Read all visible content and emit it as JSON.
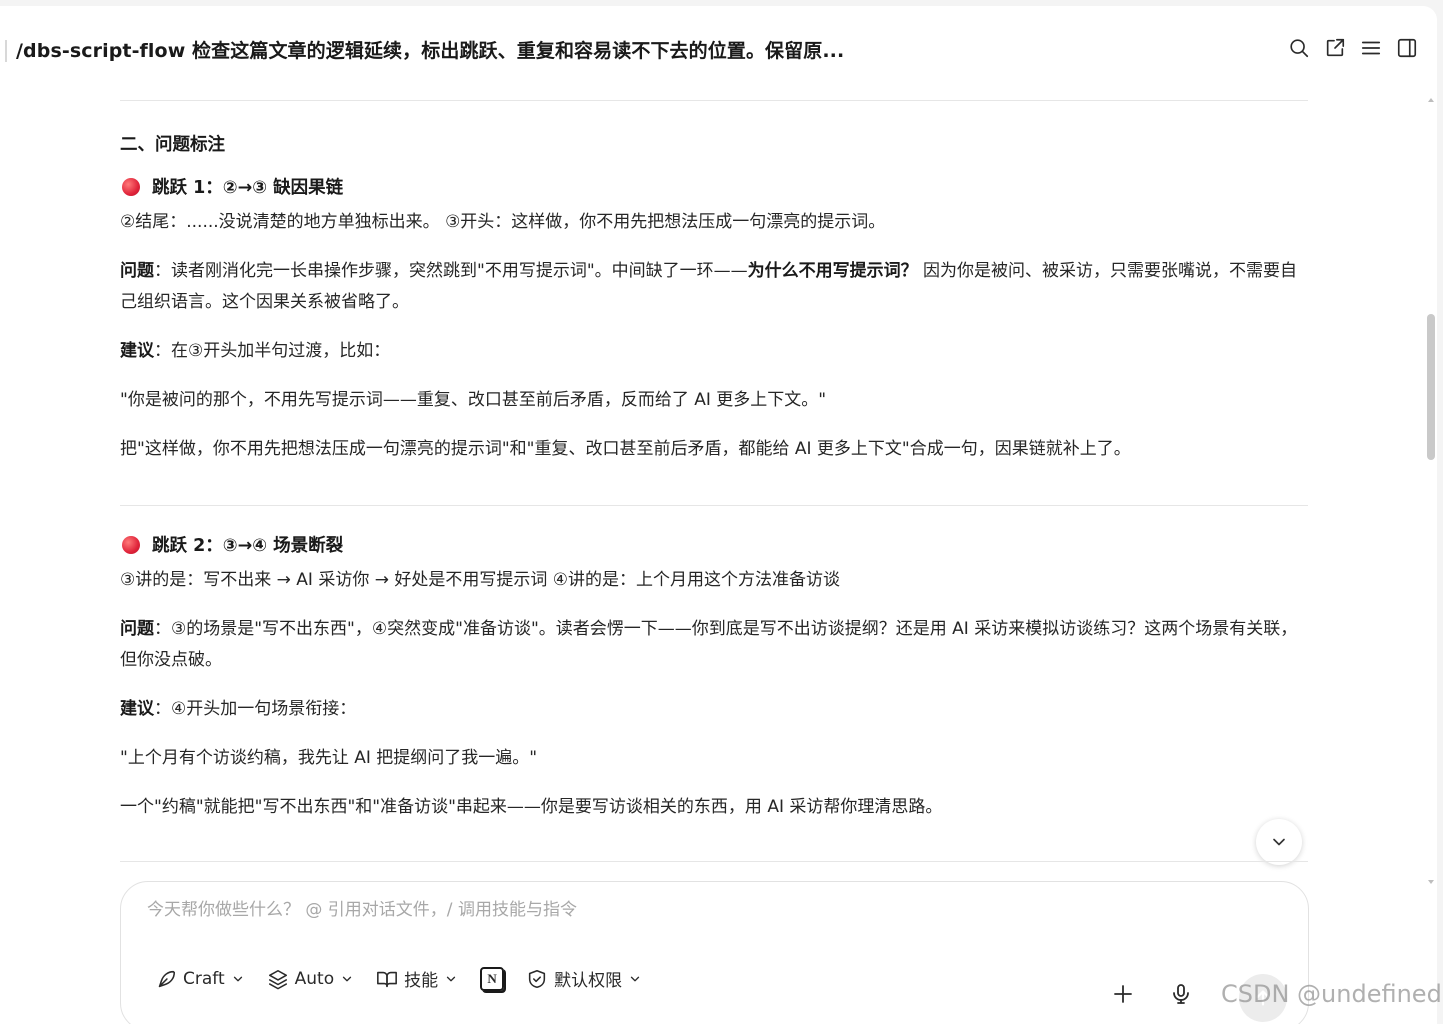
{
  "header": {
    "title": "/dbs-script-flow 检查这篇文章的逻辑延续，标出跳跃、重复和容易读不下去的位置。保留原..."
  },
  "content": {
    "section_heading": "二、问题标注",
    "issue1": {
      "title": "跳跃 1：②→③ 缺因果链",
      "context": "②结尾：......没说清楚的地方单独标出来。 ③开头：这样做，你不用先把想法压成一句漂亮的提示词。",
      "problem_label": "问题",
      "problem_pre": "：读者刚消化完一长串操作步骤，突然跳到\"不用写提示词\"。中间缺了一环——",
      "problem_bold": "为什么不用写提示词？",
      "problem_post": " 因为你是被问、被采访，只需要张嘴说，不需要自己组织语言。这个因果关系被省略了。",
      "suggestion_label": "建议",
      "suggestion": "：在③开头加半句过渡，比如：",
      "quote": "\"你是被问的那个，不用先写提示词——重复、改口甚至前后矛盾，反而给了 AI 更多上下文。\"",
      "note": "把\"这样做，你不用先把想法压成一句漂亮的提示词\"和\"重复、改口甚至前后矛盾，都能给 AI 更多上下文\"合成一句，因果链就补上了。"
    },
    "issue2": {
      "title": "跳跃 2：③→④ 场景断裂",
      "context": "③讲的是：写不出来 → AI 采访你 → 好处是不用写提示词 ④讲的是：上个月用这个方法准备访谈",
      "problem_label": "问题",
      "problem": "：③的场景是\"写不出东西\"，④突然变成\"准备访谈\"。读者会愣一下——你到底是写不出访谈提纲？还是用 AI 采访来模拟访谈练习？这两个场景有关联，但你没点破。",
      "suggestion_label": "建议",
      "suggestion": "：④开头加一句场景衔接：",
      "quote": "\"上个月有个访谈约稿，我先让 AI 把提纲问了我一遍。\"",
      "note": "一个\"约稿\"就能把\"写不出东西\"和\"准备访谈\"串起来——你是要写访谈相关的东西，用 AI 采访帮你理清思路。"
    }
  },
  "composer": {
    "placeholder": "今天帮你做些什么？ @ 引用对话文件，/ 调用技能与指令",
    "value": "",
    "mode_label": "Craft",
    "model_label": "Auto",
    "skills_label": "技能",
    "permission_label": "默认权限"
  },
  "watermark": "CSDN @undefined"
}
